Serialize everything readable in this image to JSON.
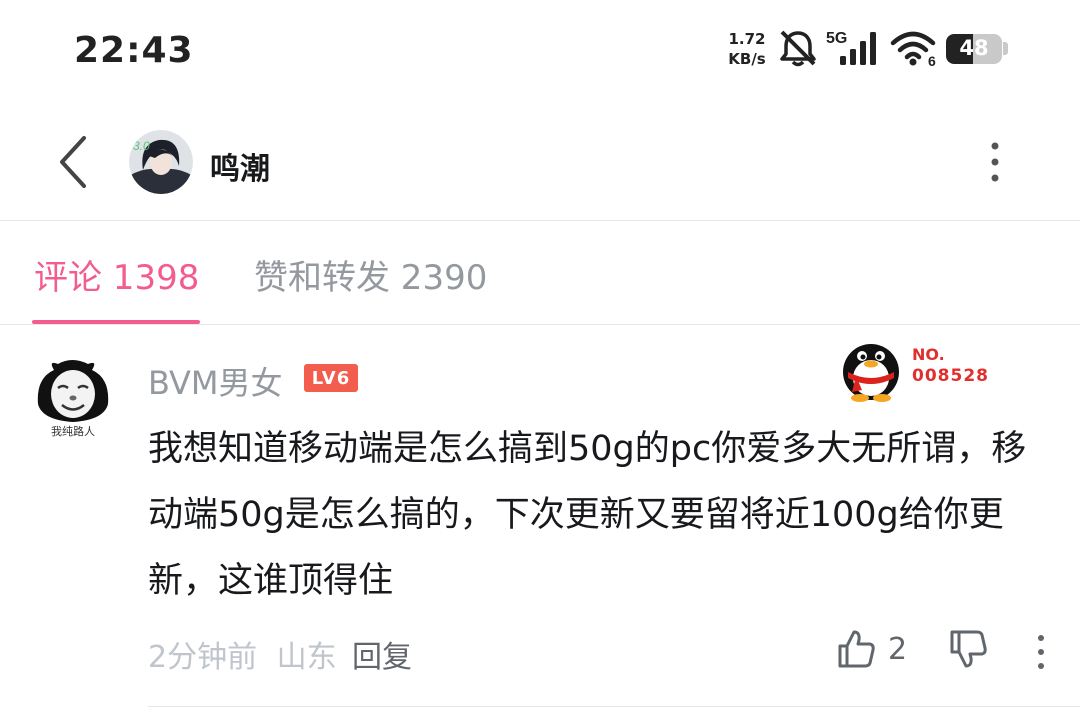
{
  "status_bar": {
    "time": "22:43",
    "net_speed_value": "1.72",
    "net_speed_unit": "KB/s",
    "network_type": "5G",
    "wifi_level": "6",
    "battery_percent": "48",
    "icons": [
      "mute-icon",
      "signal-icon",
      "wifi-icon",
      "battery-icon"
    ]
  },
  "header": {
    "title": "鸣潮",
    "back_icon": "chevron-left-icon",
    "more_icon": "vertical-ellipsis-icon"
  },
  "tabs": [
    {
      "label": "评论 1398",
      "active": true
    },
    {
      "label": "赞和转发 2390",
      "active": false
    }
  ],
  "comment": {
    "username": "BVM男女",
    "level": "LV6",
    "avatar_caption": "我纯路人",
    "fan_badge": {
      "no_label": "NO.",
      "number": "008528"
    },
    "text": "我想知道移动端是怎么搞到50g的pc你爱多大无所谓，移动端50g是怎么搞的，下次更新又要留将近100g给你更新，这谁顶得住",
    "time": "2分钟前",
    "location": "山东",
    "reply_label": "回复",
    "like_count": "2"
  },
  "colors": {
    "accent": "#f25d8e",
    "muted_text": "#9499a0",
    "level_badge": "#f25d4e",
    "fan_badge": "#e0302d"
  }
}
